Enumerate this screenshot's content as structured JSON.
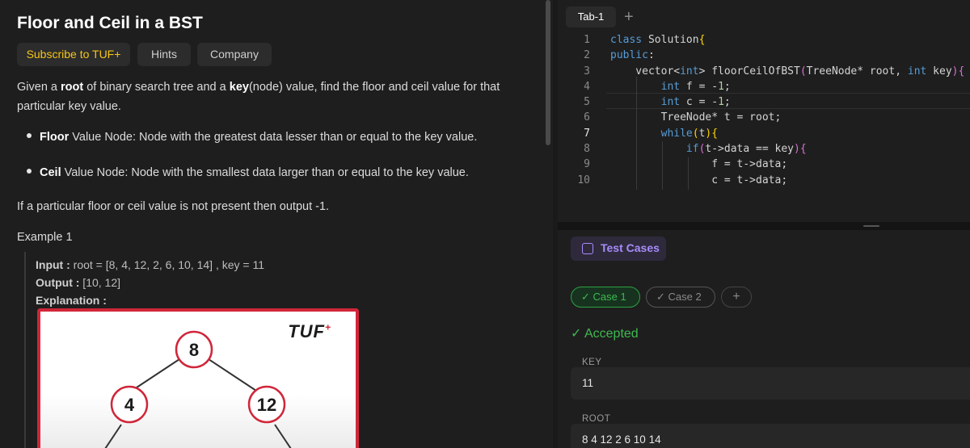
{
  "problem": {
    "title": "Floor and Ceil in a BST",
    "tabs": [
      "Subscribe to TUF+",
      "Hints",
      "Company"
    ],
    "desc_pre": "Given a ",
    "desc_root": "root",
    "desc_mid": " of binary search tree and a ",
    "desc_key": "key",
    "desc_post": "(node) value, find the floor and ceil value for that particular key value.",
    "bullet1_bold": "Floor",
    "bullet1_text": " Value Node: Node with the greatest data lesser than or equal to the key value.",
    "bullet2_bold": "Ceil",
    "bullet2_text": " Value Node: Node with the smallest data larger than or equal to the key value.",
    "note": "If a particular floor or ceil value is not present then output -1.",
    "example_heading": "Example 1",
    "example": {
      "input_label": "Input :",
      "input_value": " root = [8, 4, 12, 2, 6, 10, 14] , key = 11",
      "output_label": "Output :",
      "output_value": " [10, 12]",
      "explanation_label": "Explanation :",
      "logo_text": "TUF",
      "logo_mark": "+",
      "tree_nodes": [
        "8",
        "4",
        "12"
      ]
    }
  },
  "editor": {
    "tab_label": "Tab-1",
    "add_tab_symbol": "+",
    "active_line": 7,
    "lines": [
      "class Solution{",
      "public:",
      "    vector<int> floorCeilOfBST(TreeNode* root, int key){",
      "        int f = -1;",
      "        int c = -1;",
      "        TreeNode* t = root;",
      "        while(t){",
      "            if(t->data == key){",
      "                f = t->data;",
      "                c = t->data;"
    ]
  },
  "tests": {
    "header": "Test Cases",
    "cases": [
      "Case 1",
      "Case 2"
    ],
    "add_symbol": "+",
    "status": "Accepted",
    "fields": [
      {
        "label": "KEY",
        "value": "11"
      },
      {
        "label": "ROOT",
        "value": "8 4 12 2 6 10 14"
      }
    ]
  },
  "colors": {
    "accent_purple": "#a78bfa",
    "success_green": "#3fb950",
    "subscribe_gold": "#f5c518",
    "tree_border_red": "#d0263a"
  }
}
